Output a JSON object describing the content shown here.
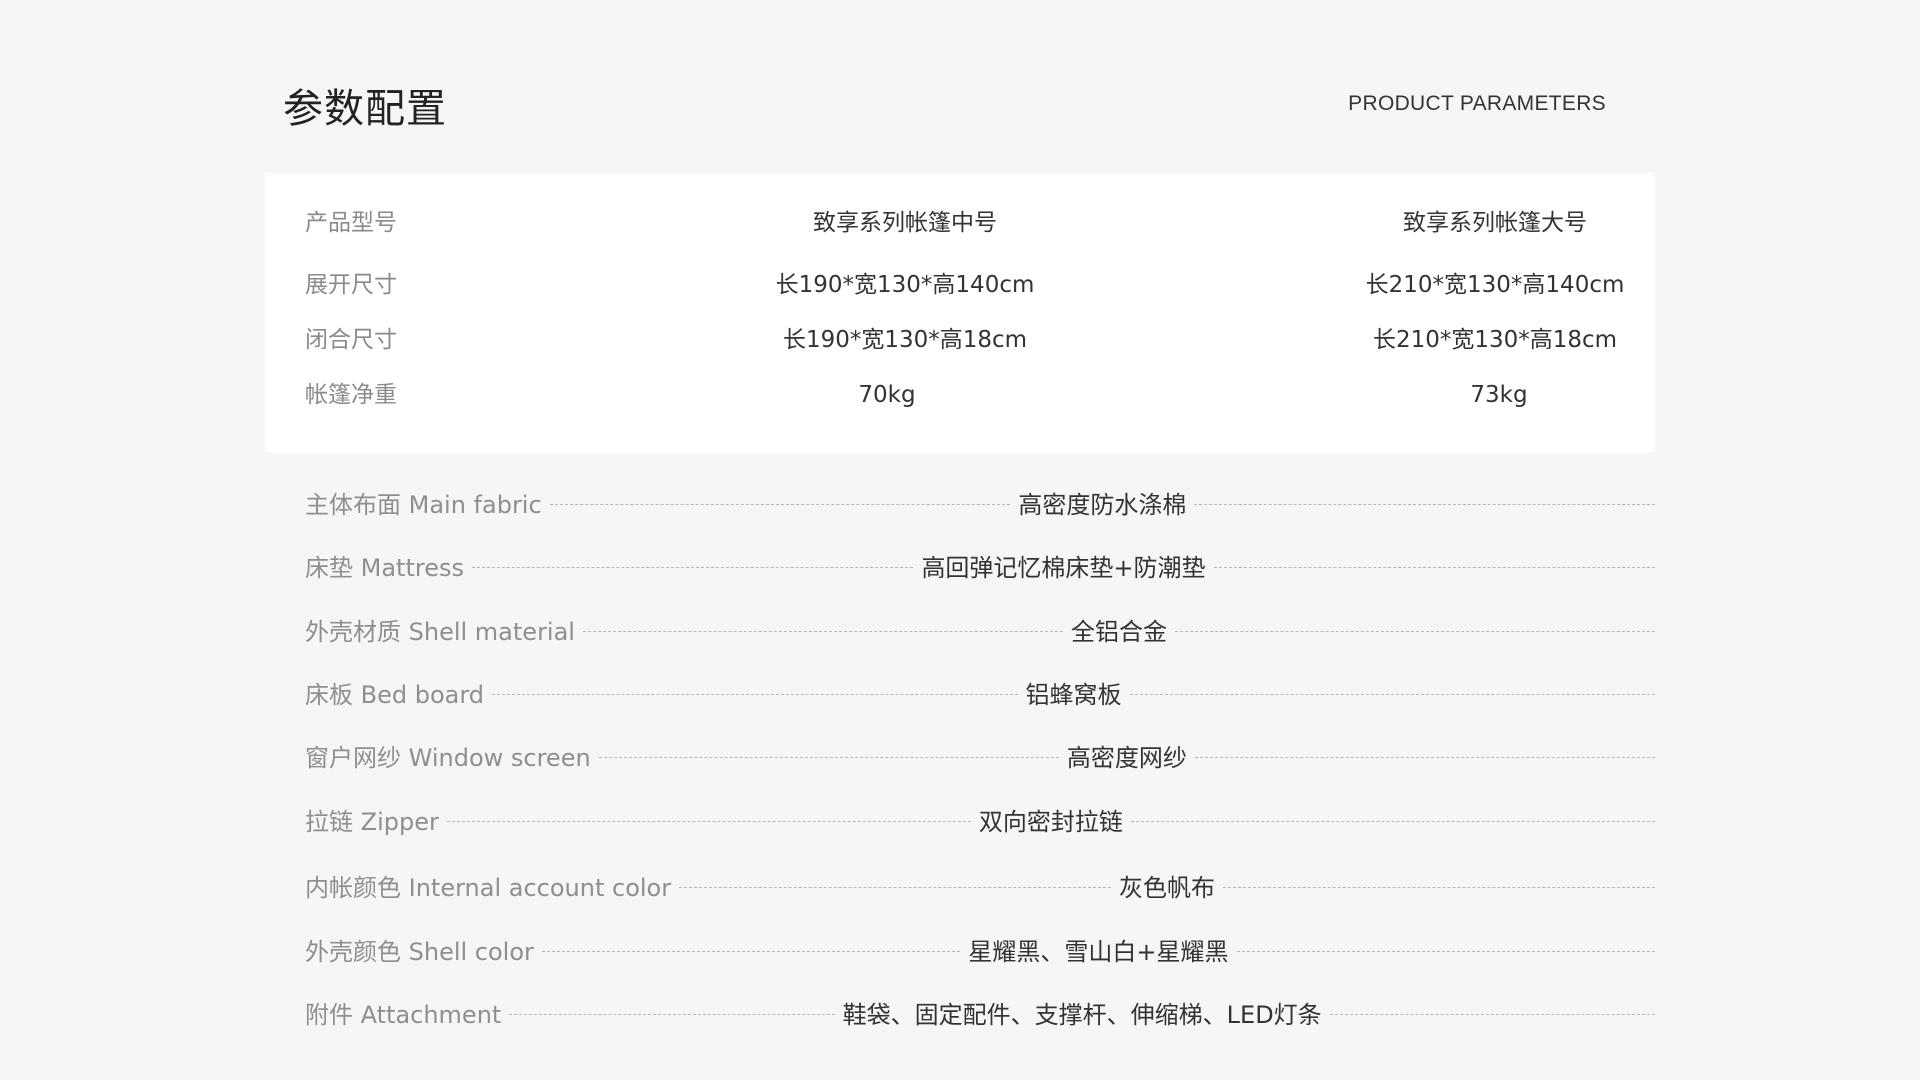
{
  "header": {
    "title": "参数配置",
    "subtitle": "PRODUCT PARAMETERS"
  },
  "spec_table": {
    "rows": [
      {
        "label": "产品型号",
        "medium": "致享系列帐篷中号",
        "large": "致享系列帐篷大号"
      },
      {
        "label": "展开尺寸",
        "medium": "长190*宽130*高140cm",
        "large": "长210*宽130*高140cm"
      },
      {
        "label": "闭合尺寸",
        "medium": "长190*宽130*高18cm",
        "large": "长210*宽130*高18cm"
      },
      {
        "label": "帐篷净重",
        "medium": "70kg",
        "large": "73kg"
      }
    ]
  },
  "materials": [
    {
      "label": "主体布面 Main fabric",
      "value": "高密度防水涤棉"
    },
    {
      "label": "床垫 Mattress",
      "value": "高回弹记忆棉床垫+防潮垫"
    },
    {
      "label": "外壳材质 Shell material",
      "value": "全铝合金"
    },
    {
      "label": "床板 Bed board",
      "value": "铝蜂窝板"
    },
    {
      "label": "窗户网纱 Window screen",
      "value": "高密度网纱"
    },
    {
      "label": "拉链 Zipper",
      "value": "双向密封拉链"
    },
    {
      "label": "内帐颜色 Internal account color",
      "value": "灰色帆布"
    },
    {
      "label": "外壳颜色 Shell color",
      "value": "星耀黑、雪山白+星耀黑"
    },
    {
      "label": "附件 Attachment",
      "value": "鞋袋、固定配件、支撑杆、伸缩梯、LED灯条"
    }
  ]
}
